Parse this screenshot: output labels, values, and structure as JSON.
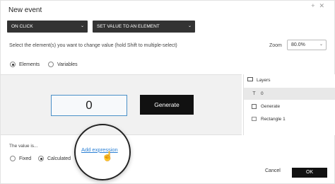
{
  "dialog": {
    "title": "New event",
    "window_icons": [
      "plus-icon",
      "close-icon"
    ],
    "trigger_select": "ON CLICK",
    "action_select": "SET VALUE TO AN ELEMENT",
    "instruction": "Select the element(s) you want to change value (hold Shift to multiple-select)",
    "zoom_label": "Zoom",
    "zoom_value": "80.0%",
    "target_tabs": [
      {
        "label": "Elements",
        "selected": true
      },
      {
        "label": "Variables",
        "selected": false
      }
    ]
  },
  "canvas": {
    "value_box_text": "0",
    "generate_button": "Generate"
  },
  "layers": {
    "title": "Layers",
    "items": [
      {
        "label": "0",
        "icon": "text-icon",
        "selected": true
      },
      {
        "label": "Generate",
        "icon": "image-icon",
        "selected": false
      },
      {
        "label": "Rectangle 1",
        "icon": "rectangle-icon",
        "selected": false
      }
    ]
  },
  "value": {
    "label": "The value is...",
    "options": [
      {
        "label": "Fixed",
        "selected": false
      },
      {
        "label": "Calculated",
        "selected": true
      }
    ],
    "add_expression": "Add expression"
  },
  "footer": {
    "cancel": "Cancel",
    "ok": "OK"
  },
  "colors": {
    "link": "#2a7fd4",
    "dark_button": "#111111",
    "select_bg": "#333333",
    "value_box_border": "#4a90c8"
  }
}
